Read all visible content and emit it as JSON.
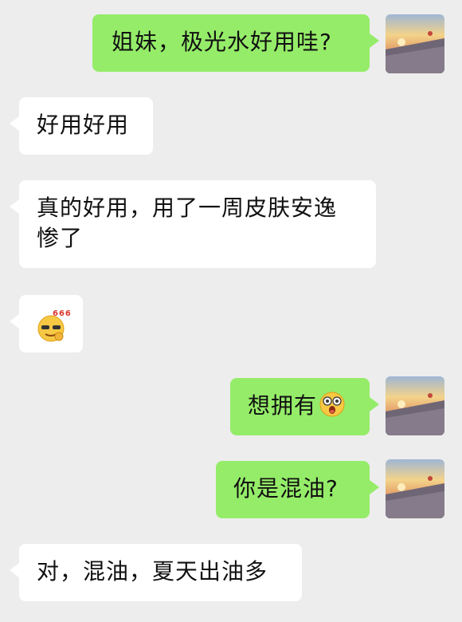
{
  "messages": [
    {
      "side": "out",
      "text": "姐妹，极光水好用哇?"
    },
    {
      "side": "in",
      "text": "好用好用"
    },
    {
      "side": "in",
      "line1": "真的好用，用了一周皮肤安逸",
      "line2": "惨了"
    },
    {
      "side": "in",
      "sticker": "666-sunglasses-emoji-icon",
      "badge": "666"
    },
    {
      "side": "out",
      "text": "想拥有",
      "emoji": "wow-face-emoji-icon"
    },
    {
      "side": "out",
      "text": "你是混油?"
    },
    {
      "side": "in",
      "text": "对，混油，夏天出油多"
    }
  ],
  "colors": {
    "background": "#ededed",
    "outgoing_bubble": "#95ec69",
    "incoming_bubble": "#ffffff"
  }
}
